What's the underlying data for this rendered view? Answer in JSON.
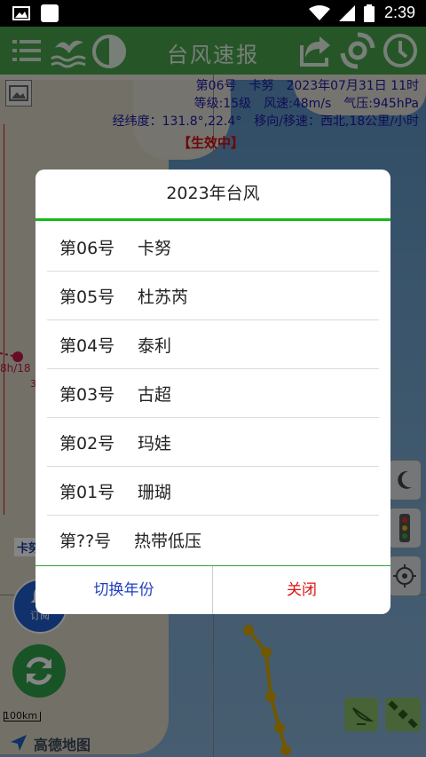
{
  "status_bar": {
    "time": "2:39"
  },
  "app_bar": {
    "title": "台风速报"
  },
  "typhoon_info": {
    "line1": "第06号　卡努　2023年07月31日 11时",
    "line2": "等级:15级　风速:48m/s　气压:945hPa",
    "line3": "经纬度：131.8°,22.4°　移向/移速：西北,18公里/小时",
    "status": "【生效中】"
  },
  "map": {
    "scale_label": "100km",
    "provider": "高德地图",
    "subscribe_label": "订阅",
    "track_label_left": "8h/18",
    "track_label_small": "3",
    "map_label_kanu": "卡努"
  },
  "dialog": {
    "title": "2023年台风",
    "items": [
      {
        "number": "第06号",
        "name": "卡努"
      },
      {
        "number": "第05号",
        "name": "杜苏芮"
      },
      {
        "number": "第04号",
        "name": "泰利"
      },
      {
        "number": "第03号",
        "name": "古超"
      },
      {
        "number": "第02号",
        "name": "玛娃"
      },
      {
        "number": "第01号",
        "name": "珊瑚"
      },
      {
        "number": "第??号",
        "name": "热带低压"
      }
    ],
    "switch_year_label": "切换年份",
    "close_label": "关闭"
  },
  "colors": {
    "accent_green": "#49a64e",
    "divider_green": "#16b916",
    "switch_blue": "#1f3fbf",
    "close_red": "#e01010"
  }
}
